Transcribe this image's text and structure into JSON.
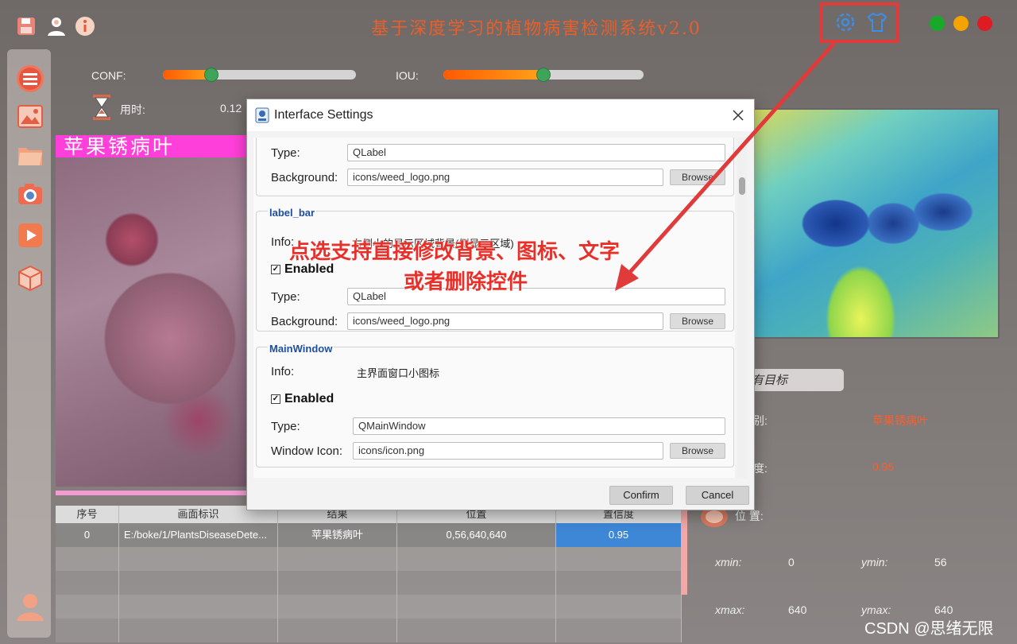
{
  "app": {
    "title": "基于深度学习的植物病害检测系统v2.0"
  },
  "colors": {
    "accent": "#e5602c",
    "dot_green": "#18a82a",
    "dot_yellow": "#f5a300",
    "dot_red": "#e01b24",
    "annotation": "#e03a3a"
  },
  "toolbar": {
    "icons": [
      "save-icon",
      "user-icon",
      "info-icon",
      "gear-icon",
      "shirt-icon"
    ]
  },
  "sidebar": {
    "icons": [
      "menu-icon",
      "image-icon",
      "folder-icon",
      "camera-icon",
      "play-icon",
      "box-icon",
      "user-avatar-icon"
    ]
  },
  "controls": {
    "conf_label": "CONF:",
    "conf_value": 0.25,
    "iou_label": "IOU:",
    "iou_value": 0.5,
    "time_label": "用时:",
    "time_value": "0.12"
  },
  "left_panel": {
    "banner": "苹果锈病叶"
  },
  "table": {
    "headers": [
      "序号",
      "画面标识",
      "结果",
      "位置",
      "置信度"
    ],
    "rows": [
      [
        "0",
        "E:/boke/1/PlantsDiseaseDete...",
        "苹果锈病叶",
        "0,56,640,640",
        "0.95"
      ]
    ]
  },
  "right_panel": {
    "target_select": "有目标",
    "result_label": "别:",
    "result_value": "苹果锈病叶",
    "conf_label": "度:",
    "conf_value": "0.95",
    "pos_label": "位  置:",
    "xmin_label": "xmin:",
    "xmin": "0",
    "ymin_label": "ymin:",
    "ymin": "56",
    "xmax_label": "xmax:",
    "xmax": "640",
    "ymax_label": "ymax:",
    "ymax": "640"
  },
  "dialog": {
    "title": "Interface Settings",
    "group0": {
      "type_label": "Type:",
      "type_value": "QLabel",
      "bg_label": "Background:",
      "bg_value": "icons/weed_logo.png",
      "browse": "Browse"
    },
    "group1": {
      "title": "label_bar",
      "info_label": "Info:",
      "info_value": "右侧小的显示区域背景(侧显示区域)",
      "enabled": "Enabled",
      "type_label": "Type:",
      "type_value": "QLabel",
      "bg_label": "Background:",
      "bg_value": "icons/weed_logo.png",
      "browse": "Browse"
    },
    "group2": {
      "title": "MainWindow",
      "info_label": "Info:",
      "info_value": "主界面窗口小图标",
      "enabled": "Enabled",
      "type_label": "Type:",
      "type_value": "QMainWindow",
      "icon_label": "Window Icon:",
      "icon_value": "icons/icon.png",
      "browse": "Browse"
    },
    "confirm": "Confirm",
    "cancel": "Cancel"
  },
  "annotation": {
    "line1": "点选支持直接修改背景、图标、文字",
    "line2": "或者删除控件"
  },
  "watermark": "CSDN @思绪无限"
}
